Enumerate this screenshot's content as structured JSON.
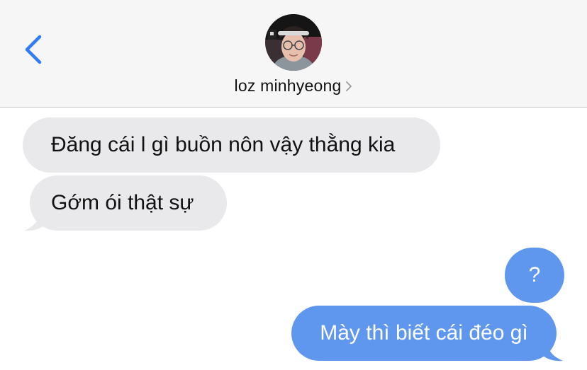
{
  "header": {
    "contact_name": "loz minhyeong",
    "back_icon": "chevron-left-icon",
    "disclosure_icon": "chevron-right-icon"
  },
  "messages": [
    {
      "direction": "incoming",
      "text": "Đăng cái l gì buồn nôn vậy thằng kia"
    },
    {
      "direction": "incoming",
      "text": "Gớm ói thật sự"
    },
    {
      "direction": "outgoing",
      "text": "?"
    },
    {
      "direction": "outgoing",
      "text": "Mày thì biết cái đéo gì"
    }
  ],
  "colors": {
    "accent": "#2f7cf6",
    "incoming_bubble": "#e9e9eb",
    "outgoing_bubble": "#5f97ee",
    "header_bg": "#f6f6f6"
  }
}
